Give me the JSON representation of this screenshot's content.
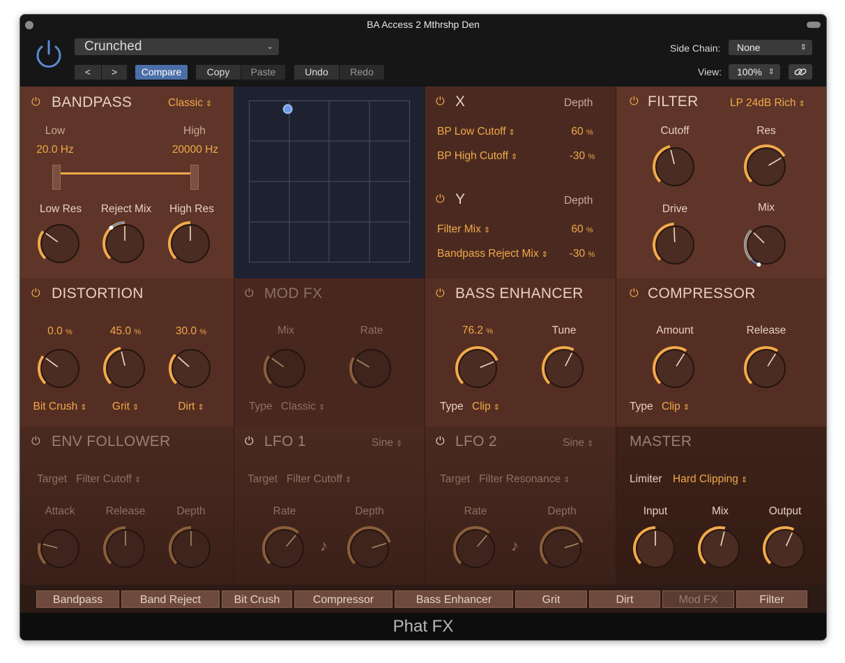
{
  "window": {
    "title": "BA Access 2 Mthrshp Den"
  },
  "header": {
    "preset_name": "Crunched",
    "prev_label": "<",
    "next_label": ">",
    "compare_label": "Compare",
    "copy_label": "Copy",
    "paste_label": "Paste",
    "undo_label": "Undo",
    "redo_label": "Redo",
    "side_chain_label": "Side Chain:",
    "side_chain_value": "None",
    "view_label": "View:",
    "view_value": "100%"
  },
  "bandpass": {
    "title": "BANDPASS",
    "mode": "Classic",
    "low_label": "Low",
    "low_value": "20.0 Hz",
    "high_label": "High",
    "high_value": "20000 Hz",
    "knobs": [
      {
        "label": "Low Res",
        "value": 0.3
      },
      {
        "label": "Reject Mix",
        "value": 0.5
      },
      {
        "label": "High Res",
        "value": 0.5
      }
    ]
  },
  "xy_pad": {
    "point": [
      0.12,
      0.04
    ]
  },
  "xy_mod": {
    "x_title": "X",
    "y_title": "Y",
    "depth_label": "Depth",
    "x_rows": [
      {
        "param": "BP Low Cutoff",
        "value": "60",
        "unit": "%"
      },
      {
        "param": "BP High Cutoff",
        "value": "-30",
        "unit": "%"
      }
    ],
    "y_rows": [
      {
        "param": "Filter Mix",
        "value": "60",
        "unit": "%"
      },
      {
        "param": "Bandpass Reject Mix",
        "value": "-30",
        "unit": "%"
      }
    ]
  },
  "filter": {
    "title": "FILTER",
    "mode": "LP 24dB Rich",
    "knobs": [
      {
        "label": "Cutoff",
        "value": 0.45
      },
      {
        "label": "Res",
        "value": 0.72
      },
      {
        "label": "Drive",
        "value": 0.49
      },
      {
        "label": "Mix",
        "value": 0.33
      }
    ]
  },
  "distortion": {
    "title": "DISTORTION",
    "knobs": [
      {
        "value_text": "0.0",
        "unit": "%",
        "label": "Bit Crush",
        "value": 0.3
      },
      {
        "value_text": "45.0",
        "unit": "%",
        "label": "Grit",
        "value": 0.45
      },
      {
        "value_text": "30.0",
        "unit": "%",
        "label": "Dirt",
        "value": 0.32
      }
    ]
  },
  "mod_fx": {
    "title": "MOD FX",
    "mix_label": "Mix",
    "rate_label": "Rate",
    "type_label": "Type",
    "type_value": "Classic"
  },
  "bass_enhancer": {
    "title": "BASS ENHANCER",
    "amount_text": "76.2",
    "amount_unit": "%",
    "tune_label": "Tune",
    "type_label": "Type",
    "type_value": "Clip",
    "amount": 0.75,
    "tune": 0.6
  },
  "compressor": {
    "title": "COMPRESSOR",
    "amount_label": "Amount",
    "release_label": "Release",
    "type_label": "Type",
    "type_value": "Clip",
    "amount": 0.62,
    "release": 0.62
  },
  "env_follower": {
    "title": "ENV FOLLOWER",
    "target_label": "Target",
    "target_value": "Filter Cutoff",
    "knobs": [
      {
        "label": "Attack",
        "value": 0.22
      },
      {
        "label": "Release",
        "value": 0.5
      },
      {
        "label": "Depth",
        "value": 0.5
      }
    ]
  },
  "lfo1": {
    "title": "LFO 1",
    "wave": "Sine",
    "target_label": "Target",
    "target_value": "Filter Cutoff",
    "rate_label": "Rate",
    "depth_label": "Depth",
    "rate": 0.65,
    "depth": 0.77
  },
  "lfo2": {
    "title": "LFO 2",
    "wave": "Sine",
    "target_label": "Target",
    "target_value": "Filter Resonance",
    "rate_label": "Rate",
    "depth_label": "Depth",
    "rate": 0.65,
    "depth": 0.77
  },
  "master": {
    "title": "MASTER",
    "limiter_label": "Limiter",
    "limiter_value": "Hard Clipping",
    "knobs": [
      {
        "label": "Input",
        "value": 0.5
      },
      {
        "label": "Mix",
        "value": 0.55
      },
      {
        "label": "Output",
        "value": 0.59
      }
    ]
  },
  "order_tabs": [
    {
      "label": "Bandpass",
      "enabled": true
    },
    {
      "label": "Band Reject",
      "enabled": true
    },
    {
      "label": "Bit Crush",
      "enabled": true
    },
    {
      "label": "Compressor",
      "enabled": true
    },
    {
      "label": "Bass Enhancer",
      "enabled": true
    },
    {
      "label": "Grit",
      "enabled": true
    },
    {
      "label": "Dirt",
      "enabled": true
    },
    {
      "label": "Mod FX",
      "enabled": false
    },
    {
      "label": "Filter",
      "enabled": true
    }
  ],
  "footer": {
    "product_name": "Phat FX"
  },
  "colors": {
    "accent": "#f1a94a",
    "mod_blue": "#5b8bd6",
    "panel": "#5e3528"
  }
}
